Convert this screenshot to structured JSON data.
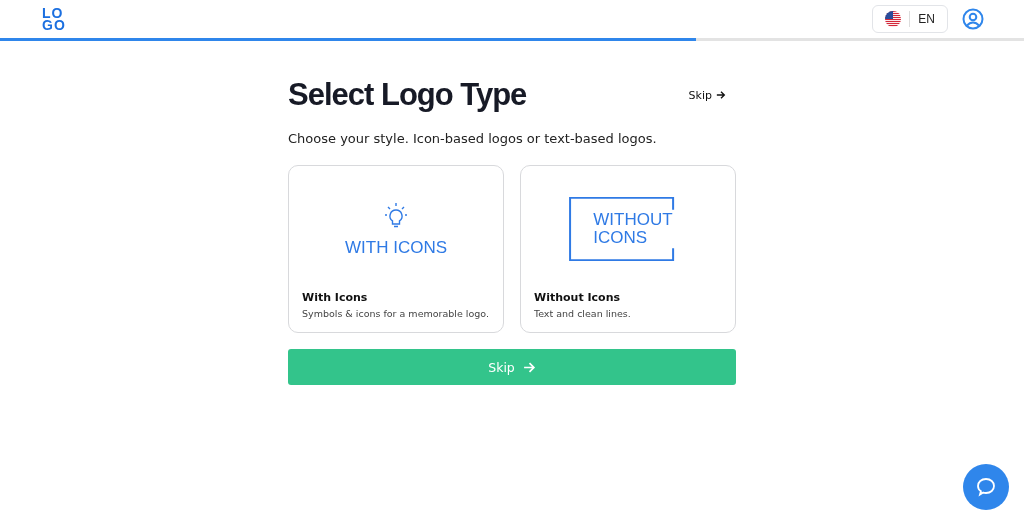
{
  "header": {
    "logo": [
      "LO",
      "GO"
    ],
    "language": "EN"
  },
  "progress": {
    "level": 0.68
  },
  "title": "Select Logo Type",
  "skip_link": "Skip",
  "subtitle": "Choose your style. Icon-based logos or text-based logos.",
  "options": [
    {
      "kind": "icon",
      "preview_lines": [
        "WITH ICONS"
      ],
      "title": "With Icons",
      "description": "Symbols & icons for a memorable logo."
    },
    {
      "kind": "frame",
      "preview_lines": [
        "WITHOUT",
        "ICONS"
      ],
      "title": "Without Icons",
      "description": "Text and clean lines."
    }
  ],
  "skip_button": "Skip"
}
